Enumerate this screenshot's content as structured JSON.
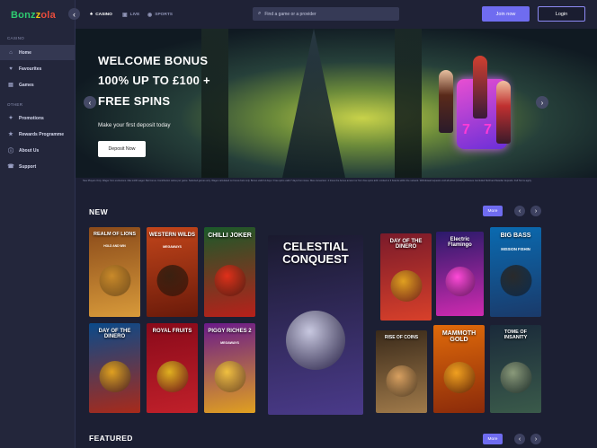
{
  "brand": {
    "logo_parts": [
      "Bonz",
      "z",
      "ola"
    ]
  },
  "sidebar": {
    "sections": [
      {
        "label": "CASINO",
        "items": [
          {
            "label": "Home",
            "icon": "home-icon",
            "active": true
          },
          {
            "label": "Favourites",
            "icon": "heart-icon"
          },
          {
            "label": "Games",
            "icon": "games-icon"
          }
        ]
      },
      {
        "label": "OTHER",
        "items": [
          {
            "label": "Promotions",
            "icon": "gift-icon"
          },
          {
            "label": "Rewards Programme",
            "icon": "star-icon"
          },
          {
            "label": "About Us",
            "icon": "info-icon"
          },
          {
            "label": "Support",
            "icon": "support-icon"
          }
        ]
      }
    ]
  },
  "topbar": {
    "tabs": [
      {
        "label": "CASINO",
        "icon": "cards-icon",
        "active": true
      },
      {
        "label": "LIVE",
        "icon": "live-icon"
      },
      {
        "label": "SPORTS",
        "icon": "ball-icon"
      }
    ],
    "search_placeholder": "Find a game or a provider",
    "join_label": "Join now",
    "login_label": "Login"
  },
  "hero": {
    "title_lines": [
      "WELCOME BONUS",
      "100% UP TO £100 +",
      "FREE SPINS"
    ],
    "subtitle": "Make your first deposit today",
    "button_label": "Deposit Now",
    "terms": "New Players Only. Wager from exclusions. Max £100 wager. Bet bonus. Contribution varies per game. Selected games only. Wager calculated on bonus bets only. Bonus valid 14 days / Free spins valid 7 days from issue. Max conversion: 2 times the bonus amount or from free spins £20. Limited to 3 brands within the network. Withdrawal requests void all active pending bonuses. Excluded Skrill and Neteller deposits. Full Terms apply."
  },
  "new_section": {
    "title": "NEW",
    "more_label": "More",
    "games": [
      {
        "name": "REALM OF LIONS",
        "sub": "HOLD AND WIN",
        "bg": [
          "#8a4a1a",
          "#d89a3a"
        ],
        "art": "#c98a2a"
      },
      {
        "name": "WESTERN WILDS",
        "sub": "MEGAWAYS",
        "bg": [
          "#c2451a",
          "#6a1a0a"
        ],
        "art": "#3a2010"
      },
      {
        "name": "CHILLI JOKER",
        "sub": "",
        "bg": [
          "#1a5a2a",
          "#b8201a"
        ],
        "art": "#e0301a"
      },
      {
        "name": "CELESTIAL CONQUEST",
        "sub": "",
        "bg": [
          "#1a1a2e",
          "#4a3a8a"
        ],
        "art": "#c8c8e0"
      },
      {
        "name": "DAY OF THE DINERO",
        "sub": "",
        "bg": [
          "#7a1a2a",
          "#d8402a"
        ],
        "art": "#e0a020"
      },
      {
        "name": "Electric Flamingo",
        "sub": "",
        "bg": [
          "#2a1a6a",
          "#d02ab0"
        ],
        "art": "#ff4ad8"
      },
      {
        "name": "BIG BASS",
        "sub": "MISSION FISHIN",
        "bg": [
          "#0a6ab0",
          "#1a3a6a"
        ],
        "art": "#2a2a2a"
      },
      {
        "name": "DAY OF THE DINERO",
        "sub": "",
        "bg": [
          "#0a4a8a",
          "#a82a1a"
        ],
        "art": "#e0a020"
      },
      {
        "name": "ROYAL FRUITS",
        "sub": "",
        "bg": [
          "#8a0a1a",
          "#c0202a"
        ],
        "art": "#e0b020"
      },
      {
        "name": "PIGGY RICHES 2",
        "sub": "MEGAWAYS",
        "bg": [
          "#6a1a8a",
          "#e0a020"
        ],
        "art": "#f0c040"
      },
      {
        "name": "RISE OF COINS",
        "sub": "",
        "bg": [
          "#3a2a1a",
          "#a07a4a"
        ],
        "art": "#d8a060"
      },
      {
        "name": "MAMMOTH GOLD",
        "sub": "",
        "bg": [
          "#e06a0a",
          "#8a2a0a"
        ],
        "art": "#f0a020"
      },
      {
        "name": "TOME OF INSANITY",
        "sub": "",
        "bg": [
          "#1a2a3a",
          "#3a5a4a"
        ],
        "art": "#8a9a7a"
      }
    ]
  },
  "featured_section": {
    "title": "FEATURED",
    "more_label": "More"
  },
  "arrows": {
    "prev": "‹",
    "next": "›"
  }
}
